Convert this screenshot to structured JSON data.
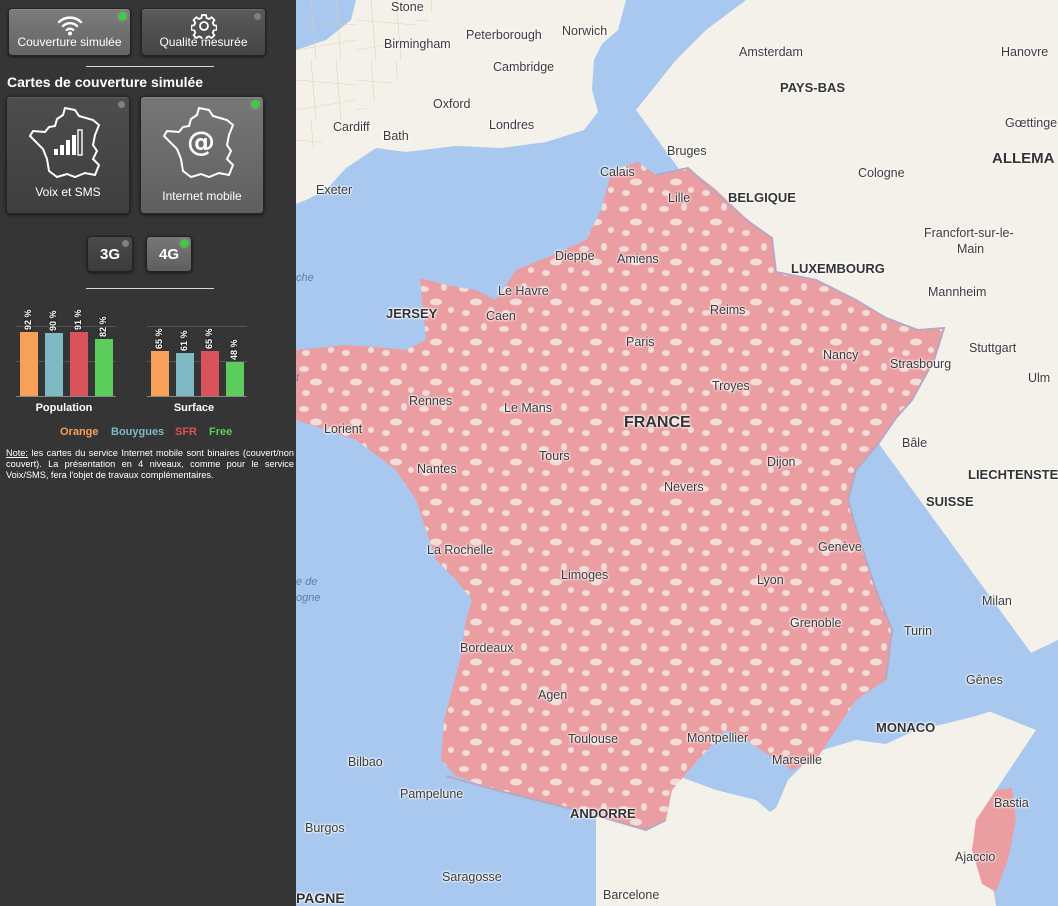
{
  "top_tabs": [
    {
      "label": "Couverture simulée",
      "icon": "wifi-icon",
      "active": true
    },
    {
      "label": "Qualité mesurée",
      "icon": "gear-icon",
      "active": false
    }
  ],
  "section_title": "Cartes de couverture simulée",
  "map_types": [
    {
      "label": "Voix et SMS",
      "icon": "france-signal-bars-icon",
      "active": false
    },
    {
      "label": "Internet mobile",
      "icon": "france-at-icon",
      "active": true
    }
  ],
  "technologies": [
    {
      "label": "3G",
      "active": false
    },
    {
      "label": "4G",
      "active": true
    }
  ],
  "chart_data": {
    "type": "bar",
    "categories": [
      "Population",
      "Surface"
    ],
    "series": [
      {
        "name": "Orange",
        "color": "#f7a05a",
        "values": [
          92,
          65
        ],
        "labels": [
          "92 %",
          "65 %"
        ]
      },
      {
        "name": "Bouygues",
        "color": "#7fbac4",
        "values": [
          90,
          61
        ],
        "labels": [
          "90 %",
          "61 %"
        ]
      },
      {
        "name": "SFR",
        "color": "#d9535c",
        "values": [
          91,
          65
        ],
        "labels": [
          "91 %",
          "65 %"
        ]
      },
      {
        "name": "Free",
        "color": "#5ccd5c",
        "values": [
          82,
          48
        ],
        "labels": [
          "82 %",
          "48 %"
        ]
      }
    ],
    "ylim": [
      0,
      100
    ],
    "legend": "bottom"
  },
  "note": {
    "prefix": "Note:",
    "text": " les cartes du service Internet mobile sont binaires (couvert/non couvert). La présentation en 4 niveaux, comme pour le service Voix/SMS, fera l'objet de travaux complémentaires."
  },
  "map": {
    "colors": {
      "coverage": "#ea9ea2",
      "land": "#f4f1ea",
      "sea": "#a9c8ef",
      "border": "#b9a8c3"
    },
    "places": {
      "stone": "Stone",
      "birmingham": "Birmingham",
      "peterborough": "Peterborough",
      "norwich": "Norwich",
      "cambridge": "Cambridge",
      "oxford": "Oxford",
      "cardiff": "Cardiff",
      "bath": "Bath",
      "londres": "Londres",
      "exeter": "Exeter",
      "amsterdam": "Amsterdam",
      "hanovre": "Hanovre",
      "paysbas": "PAYS-BAS",
      "goettingen": "Gœttingen",
      "bruges": "Bruges",
      "allemagne": "ALLEMA",
      "calais": "Calais",
      "lille": "Lille",
      "belgique": "BELGIQUE",
      "cologne": "Cologne",
      "francfort1": "Francfort-sur-le-",
      "francfort2": "Main",
      "dieppe": "Dieppe",
      "amiens": "Amiens",
      "luxembourg": "LUXEMBOURG",
      "jersey": "JERSEY",
      "lehavre": "Le Havre",
      "mannheim": "Mannheim",
      "caen": "Caen",
      "reims": "Reims",
      "paris": "Paris",
      "nancy": "Nancy",
      "strasbourg": "Strasbourg",
      "stuttgart": "Stuttgart",
      "ulm": "Ulm",
      "troyes": "Troyes",
      "rennes": "Rennes",
      "lemans": "Le Mans",
      "lorient": "Lorient",
      "france": "FRANCE",
      "bale": "Bâle",
      "nantes": "Nantes",
      "tours": "Tours",
      "dijon": "Dijon",
      "liechtenstein": "LIECHTENSTEI",
      "nevers": "Nevers",
      "suisse": "SUISSE",
      "larochelle": "La Rochelle",
      "geneve": "Genève",
      "limoges": "Limoges",
      "lyon": "Lyon",
      "milan": "Milan",
      "grenoble": "Grenoble",
      "turin": "Turin",
      "bordeaux": "Bordeaux",
      "genes": "Gênes",
      "agen": "Agen",
      "monaco": "MONACO",
      "toulouse": "Toulouse",
      "montpellier": "Montpellier",
      "bilbao": "Bilbao",
      "marseille": "Marseille",
      "pampelune": "Pampelune",
      "bastia": "Bastia",
      "andorre": "ANDORRE",
      "burgos": "Burgos",
      "ajaccio": "Ajaccio",
      "saragosse": "Saragosse",
      "barcelone": "Barcelone",
      "espagne": "PAGNE",
      "sea1": "che",
      "sea2": "e de",
      "sea3": "ogne",
      "sea4": "t"
    }
  }
}
